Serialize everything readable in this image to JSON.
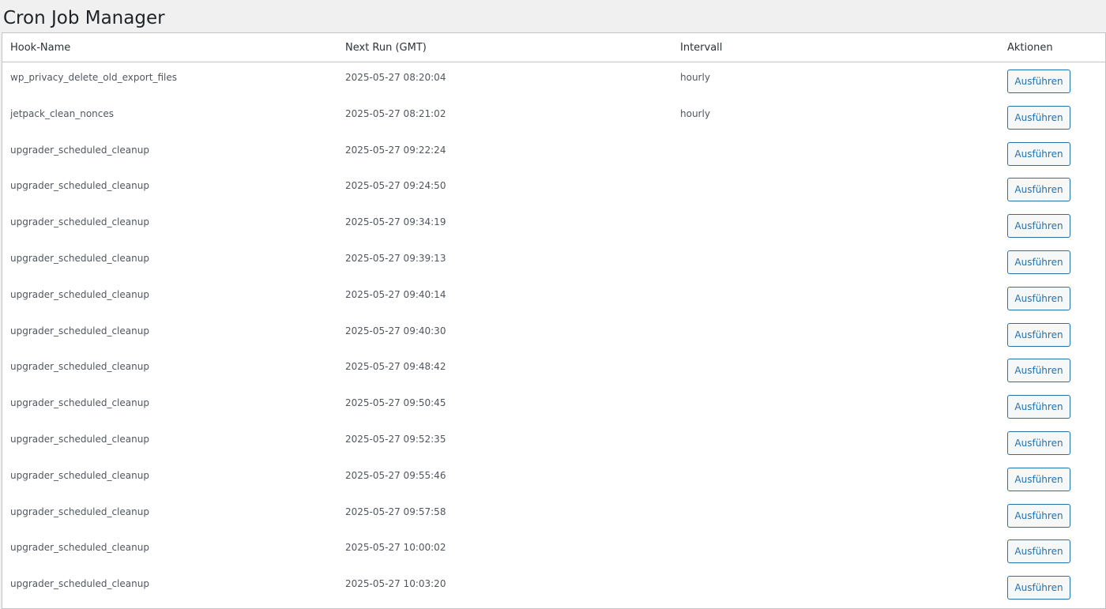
{
  "page": {
    "title": "Cron Job Manager"
  },
  "table": {
    "headers": {
      "hook": "Hook-Name",
      "next_run": "Next Run (GMT)",
      "interval": "Intervall",
      "actions": "Aktionen"
    },
    "rows": [
      {
        "hook": "wp_privacy_delete_old_export_files",
        "next_run": "2025-05-27 08:20:04",
        "interval": "hourly",
        "action": "Ausführen"
      },
      {
        "hook": "jetpack_clean_nonces",
        "next_run": "2025-05-27 08:21:02",
        "interval": "hourly",
        "action": "Ausführen"
      },
      {
        "hook": "upgrader_scheduled_cleanup",
        "next_run": "2025-05-27 09:22:24",
        "interval": "",
        "action": "Ausführen"
      },
      {
        "hook": "upgrader_scheduled_cleanup",
        "next_run": "2025-05-27 09:24:50",
        "interval": "",
        "action": "Ausführen"
      },
      {
        "hook": "upgrader_scheduled_cleanup",
        "next_run": "2025-05-27 09:34:19",
        "interval": "",
        "action": "Ausführen"
      },
      {
        "hook": "upgrader_scheduled_cleanup",
        "next_run": "2025-05-27 09:39:13",
        "interval": "",
        "action": "Ausführen"
      },
      {
        "hook": "upgrader_scheduled_cleanup",
        "next_run": "2025-05-27 09:40:14",
        "interval": "",
        "action": "Ausführen"
      },
      {
        "hook": "upgrader_scheduled_cleanup",
        "next_run": "2025-05-27 09:40:30",
        "interval": "",
        "action": "Ausführen"
      },
      {
        "hook": "upgrader_scheduled_cleanup",
        "next_run": "2025-05-27 09:48:42",
        "interval": "",
        "action": "Ausführen"
      },
      {
        "hook": "upgrader_scheduled_cleanup",
        "next_run": "2025-05-27 09:50:45",
        "interval": "",
        "action": "Ausführen"
      },
      {
        "hook": "upgrader_scheduled_cleanup",
        "next_run": "2025-05-27 09:52:35",
        "interval": "",
        "action": "Ausführen"
      },
      {
        "hook": "upgrader_scheduled_cleanup",
        "next_run": "2025-05-27 09:55:46",
        "interval": "",
        "action": "Ausführen"
      },
      {
        "hook": "upgrader_scheduled_cleanup",
        "next_run": "2025-05-27 09:57:58",
        "interval": "",
        "action": "Ausführen"
      },
      {
        "hook": "upgrader_scheduled_cleanup",
        "next_run": "2025-05-27 10:00:02",
        "interval": "",
        "action": "Ausführen"
      },
      {
        "hook": "upgrader_scheduled_cleanup",
        "next_run": "2025-05-27 10:03:20",
        "interval": "",
        "action": "Ausführen"
      }
    ]
  },
  "colors": {
    "page_background": "#f0f0f1",
    "button_accent": "#2271b1",
    "border": "#c3c4c7"
  }
}
